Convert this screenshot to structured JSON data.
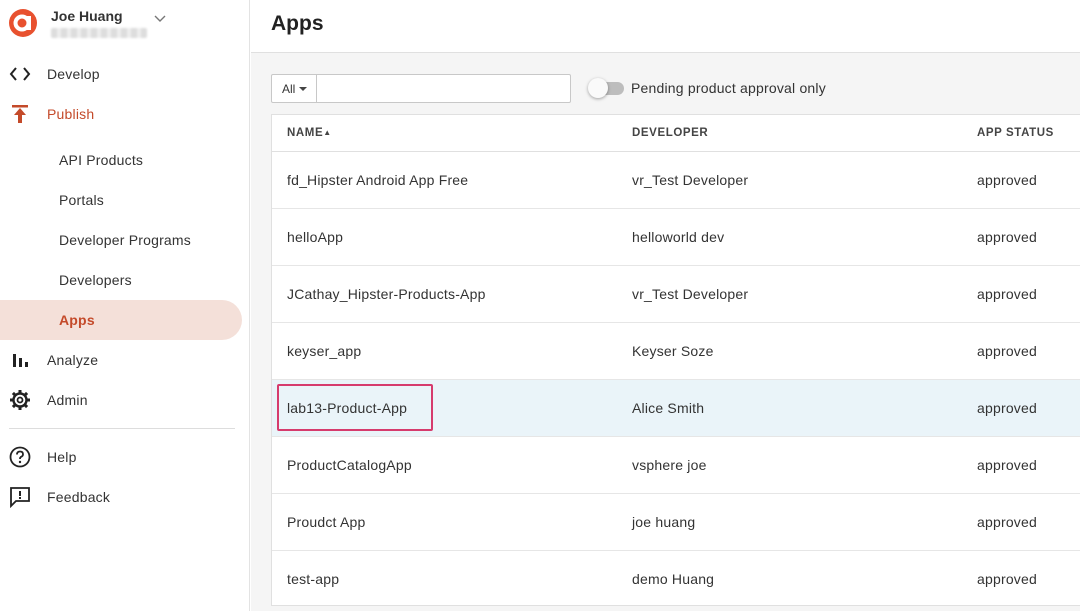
{
  "user": {
    "name": "Joe Huang"
  },
  "nav": {
    "develop": "Develop",
    "publish": "Publish",
    "sub": [
      "API Products",
      "Portals",
      "Developer Programs",
      "Developers",
      "Apps"
    ],
    "analyze": "Analyze",
    "admin": "Admin",
    "help": "Help",
    "feedback": "Feedback"
  },
  "page": {
    "title": "Apps"
  },
  "filter": {
    "select_value": "All",
    "search_value": "",
    "toggle_label": "Pending product approval only",
    "toggle_on": false
  },
  "table": {
    "headers": [
      "NAME",
      "DEVELOPER",
      "APP STATUS"
    ],
    "sort_indicator": "▲",
    "rows": [
      [
        "fd_Hipster Android App Free",
        "vr_Test Developer",
        "approved"
      ],
      [
        "helloApp",
        "helloworld dev",
        "approved"
      ],
      [
        "JCathay_Hipster-Products-App",
        "vr_Test Developer",
        "approved"
      ],
      [
        "keyser_app",
        "Keyser Soze",
        "approved"
      ],
      [
        "lab13-Product-App",
        "Alice Smith",
        "approved"
      ],
      [
        "ProductCatalogApp",
        "vsphere joe",
        "approved"
      ],
      [
        "Proudct App",
        "joe huang",
        "approved"
      ],
      [
        "test-app",
        "demo Huang",
        "approved"
      ]
    ]
  },
  "colors": {
    "accent": "#c44a2a",
    "selected_bg": "#f4e0d9",
    "highlight_row": "#eaf4f9",
    "annotation": "#d63b6d"
  }
}
